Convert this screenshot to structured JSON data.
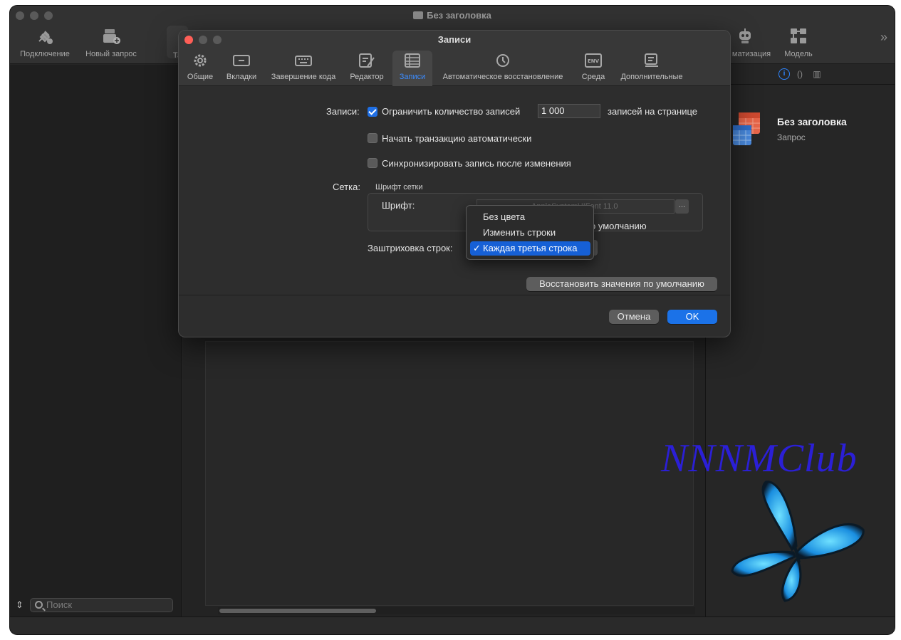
{
  "window": {
    "title": "Без заголовка"
  },
  "toolbar": {
    "items": [
      {
        "label": "Подключение"
      },
      {
        "label": "Новый запрос"
      },
      {
        "label": "Та"
      },
      {
        "label": "матизация"
      },
      {
        "label": "Модель"
      }
    ],
    "overflow": "»"
  },
  "sidebar": {
    "search_placeholder": "Поиск",
    "sort_icon": "⇕"
  },
  "inspector": {
    "tabs": [
      "i",
      "()",
      "▥"
    ],
    "title": "Без заголовка",
    "subtitle": "Запрос"
  },
  "watermark": {
    "text": "NNNMClub"
  },
  "dialog": {
    "title": "Записи",
    "tabs": [
      {
        "label": "Общие",
        "icon": "gear-icon"
      },
      {
        "label": "Вкладки",
        "icon": "tab-icon"
      },
      {
        "label": "Завершение кода",
        "icon": "keyboard-icon"
      },
      {
        "label": "Редактор",
        "icon": "edit-icon"
      },
      {
        "label": "Записи",
        "icon": "table-icon",
        "active": true
      },
      {
        "label": "Автоматическое восстановление",
        "icon": "history-icon"
      },
      {
        "label": "Среда",
        "icon": "env-icon"
      },
      {
        "label": "Дополнительные",
        "icon": "advanced-icon"
      }
    ],
    "records": {
      "label": "Записи:",
      "limit_label": "Ограничить количество записей",
      "limit_checked": true,
      "limit_value": "1 000",
      "per_page_label": "записей на странице",
      "auto_tx_label": "Начать транзакцию автоматически",
      "auto_tx_checked": false,
      "sync_label": "Синхронизировать запись после изменения",
      "sync_checked": false
    },
    "grid": {
      "label": "Сетка:",
      "group_title": "Шрифт сетки",
      "font_label": "Шрифт:",
      "font_value": "AppleSystemUIFont 11.0",
      "font_button": "...",
      "default_label": "о умолчанию",
      "shading_label": "Заштриховка строк:"
    },
    "shading_menu": {
      "options": [
        "Без цвета",
        "Изменить строки",
        "Каждая третья строка"
      ],
      "selected": "Каждая третья строка",
      "check": "✓"
    },
    "restore_button": "Восстановить значения по умолчанию",
    "cancel_button": "Отмена",
    "ok_button": "OK"
  },
  "colors": {
    "accent": "#1b72e8",
    "watermark": "#2b1fd6"
  }
}
